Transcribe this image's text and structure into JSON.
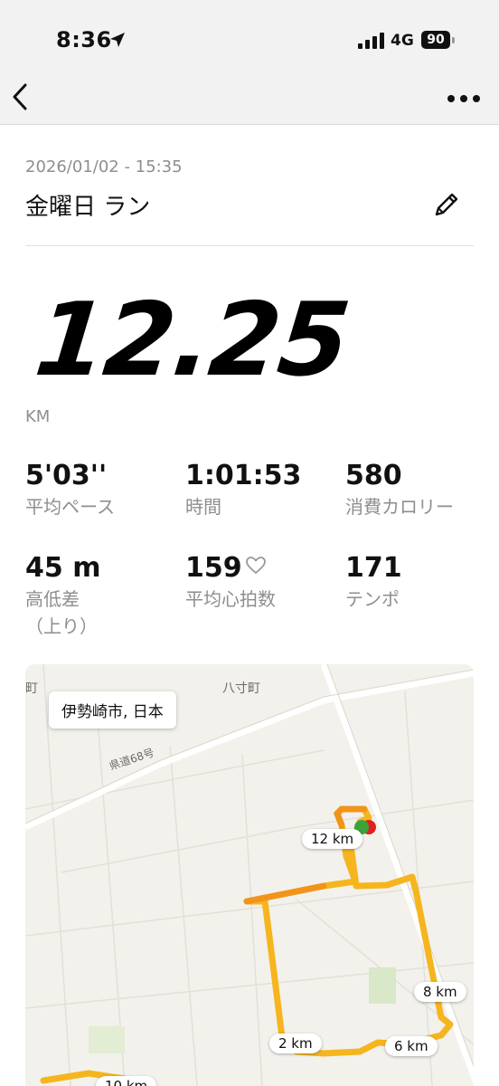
{
  "status_bar": {
    "time": "8:36",
    "network": "4G",
    "battery": "90"
  },
  "activity": {
    "date": "2026/01/02 - 15:35",
    "title": "金曜日 ラン",
    "distance": "12.25",
    "distance_unit": "KM"
  },
  "stats": [
    {
      "value": "5'03''",
      "label": "平均ペース"
    },
    {
      "value": "1:01:53",
      "label": "時間"
    },
    {
      "value": "580",
      "label": "消費カロリー"
    },
    {
      "value": "45 m",
      "label": "高低差\n（上り）"
    },
    {
      "value": "159",
      "label": "平均心拍数"
    },
    {
      "value": "171",
      "label": "テンポ"
    }
  ],
  "map": {
    "location": "伊勢崎市, 日本",
    "place_label_1": "八寸町",
    "place_label_2": "町",
    "road_label": "県道68号",
    "markers": [
      "12 km",
      "8 km",
      "2 km",
      "6 km",
      "10 km"
    ],
    "route_color": "#f5b51f",
    "start_color": "#3aa33a",
    "end_color": "#e02020"
  },
  "icons": {
    "back": "chevron-left-icon",
    "more": "ellipsis-icon",
    "edit": "pencil-icon",
    "heart": "heart-outline-icon",
    "location_arrow": "location-arrow-icon"
  }
}
